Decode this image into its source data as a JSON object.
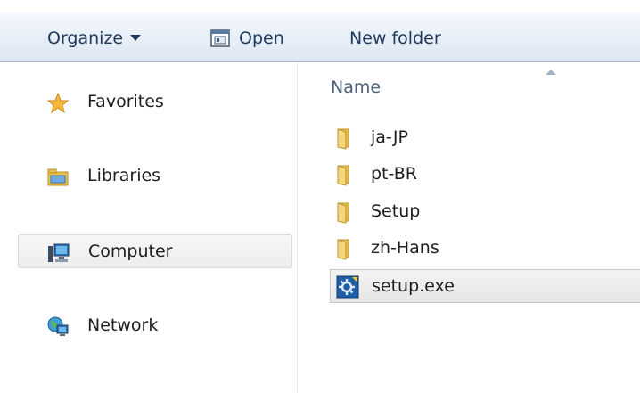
{
  "toolbar": {
    "organize_label": "Organize",
    "open_label": "Open",
    "new_folder_label": "New folder"
  },
  "nav": {
    "favorites": "Favorites",
    "libraries": "Libraries",
    "computer": "Computer",
    "network": "Network"
  },
  "content": {
    "column_header": "Name",
    "items": [
      {
        "label": "ja-JP",
        "icon": "folder-icon"
      },
      {
        "label": "pt-BR",
        "icon": "folder-icon"
      },
      {
        "label": "Setup",
        "icon": "folder-icon"
      },
      {
        "label": "zh-Hans",
        "icon": "folder-icon"
      },
      {
        "label": "setup.exe",
        "icon": "setup-exe-icon",
        "selected": true
      }
    ]
  },
  "colors": {
    "toolbar_text": "#1e395b",
    "folder_yellow": "#e8c24f",
    "selection_bg": "#e9e9e9"
  }
}
